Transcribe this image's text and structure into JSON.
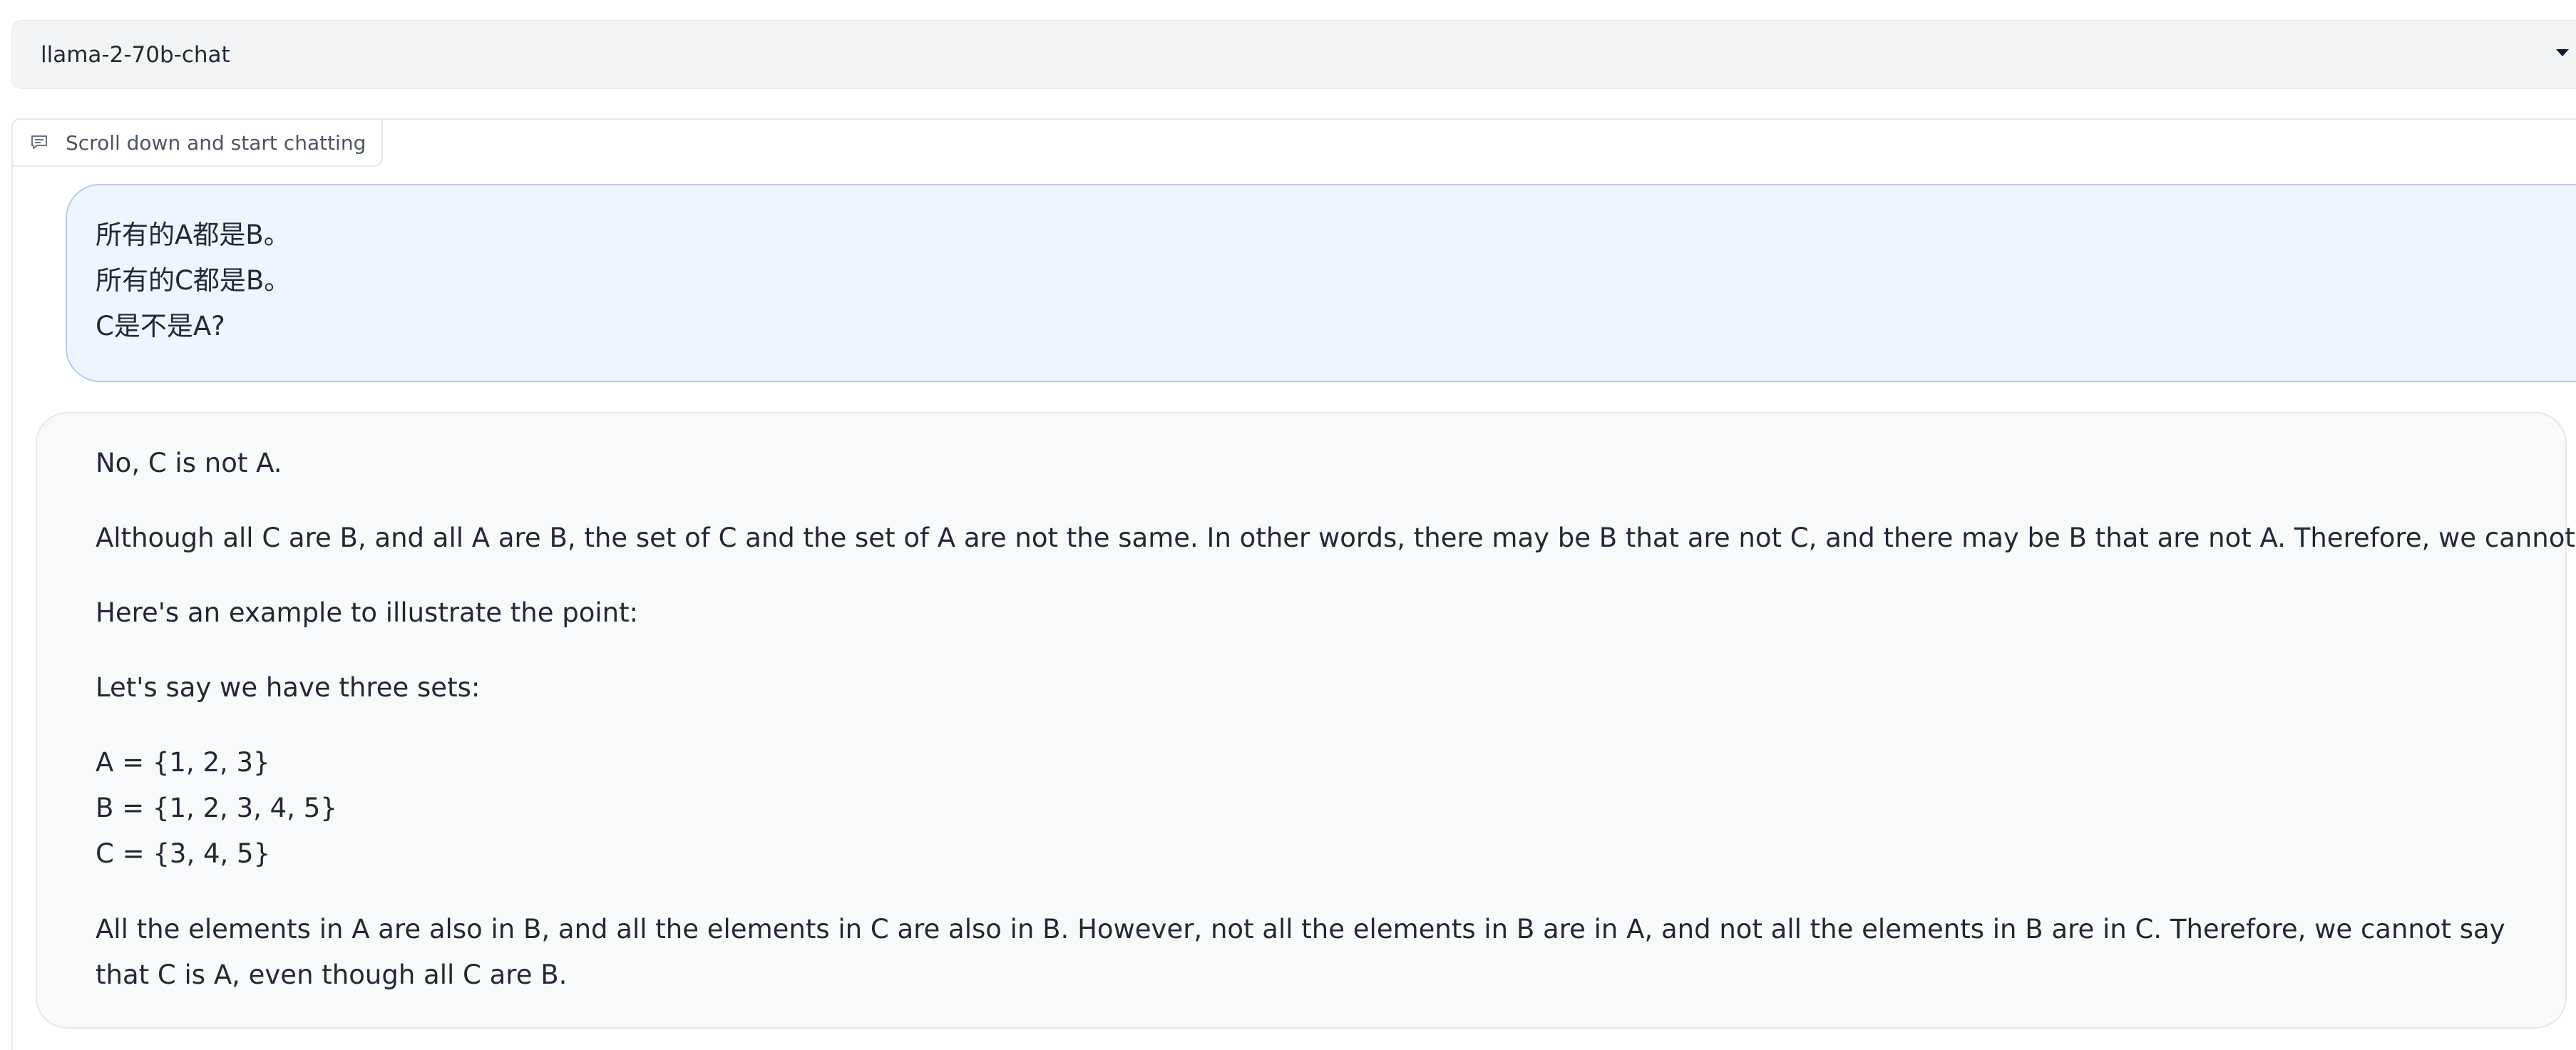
{
  "model_selector": {
    "value": "llama-2-70b-chat"
  },
  "chatbot": {
    "label": "Scroll down and start chatting",
    "label_icon": "chat-bubble-icon",
    "user_message": {
      "lines": [
        "所有的A都是B。",
        "所有的C都是B。",
        "C是不是A?"
      ]
    },
    "bot_message": {
      "paragraphs": [
        "No, C is not A.",
        "Although all C are B, and all A are B, the set of C and the set of A are not the same. In other words, there may be B that are not C, and there may be B that are not A. Therefore, we cannot conclude that C is A.",
        "Here's an example to illustrate the point:",
        "Let's say we have three sets:",
        "A = {1, 2, 3}",
        "B = {1, 2, 3, 4, 5}",
        "C = {3, 4, 5}",
        "All the elements in A are also in B, and all the elements in C are also in B. However, not all the elements in B are in A, and not all the elements in B are in C. Therefore, we cannot say that C is A, even though all C are B."
      ]
    }
  },
  "colors": {
    "user_bubble_bg": "#eff5fe",
    "user_bubble_border": "#b4cdf0",
    "bot_bubble_bg": "#f8f9fb",
    "dropdown_bg": "#f3f4f6"
  }
}
